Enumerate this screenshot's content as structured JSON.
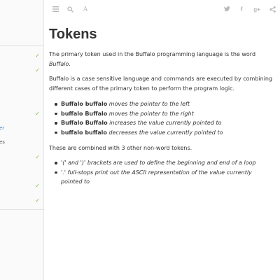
{
  "sidebar": {
    "items": [
      {
        "label": "",
        "checked": true,
        "active": false
      },
      {
        "label": "",
        "checked": true,
        "active": false
      },
      {
        "label": "",
        "checked": true,
        "active": false
      },
      {
        "label": "er",
        "checked": false,
        "active": true
      },
      {
        "label": "es",
        "checked": false,
        "active": false
      },
      {
        "label": "",
        "checked": true,
        "active": false
      },
      {
        "label": "",
        "checked": true,
        "active": false
      },
      {
        "label": "",
        "checked": true,
        "active": false
      }
    ],
    "check_glyph": "✓"
  },
  "toolbar": {
    "left_icons": [
      "menu-icon",
      "search-icon",
      "font-icon"
    ],
    "font_glyph": "A",
    "right_icons": [
      "twitter-icon",
      "facebook-icon",
      "google-plus-icon",
      "share-icon"
    ],
    "facebook_glyph": "f",
    "google_plus_glyph": "g+"
  },
  "page": {
    "title": "Tokens",
    "intro_text": "The primary token used in the Buffalo programming language is the word ",
    "intro_word": "Buffalo",
    "intro_end": ".",
    "para2": "Buffalo is a case sensitive language and commands are executed by combining different cases of the primary token to perform the program logic.",
    "commands": [
      {
        "token": "Buffalo buffalo",
        "desc": "moves the pointer to the left"
      },
      {
        "token": "buffalo Buffalo",
        "desc": "moves the pointer to the right"
      },
      {
        "token": "Buffalo Buffalo",
        "desc": "increases the value currently pointed to"
      },
      {
        "token": "buffalo buffalo",
        "desc": "decreases the value currently pointed to"
      }
    ],
    "para3": "These are combined with 3 other non-word tokens.",
    "non_word": [
      {
        "token": "'(' and ')'",
        "desc": "brackets are used to define the beginning and end of a loop"
      },
      {
        "token": "'.'",
        "desc": "full-stops print out the ASCII representation of the value currently pointed to"
      }
    ]
  },
  "colors": {
    "accent": "#4183c4",
    "check": "#7bbf3b",
    "icon": "#b8b8b8"
  }
}
